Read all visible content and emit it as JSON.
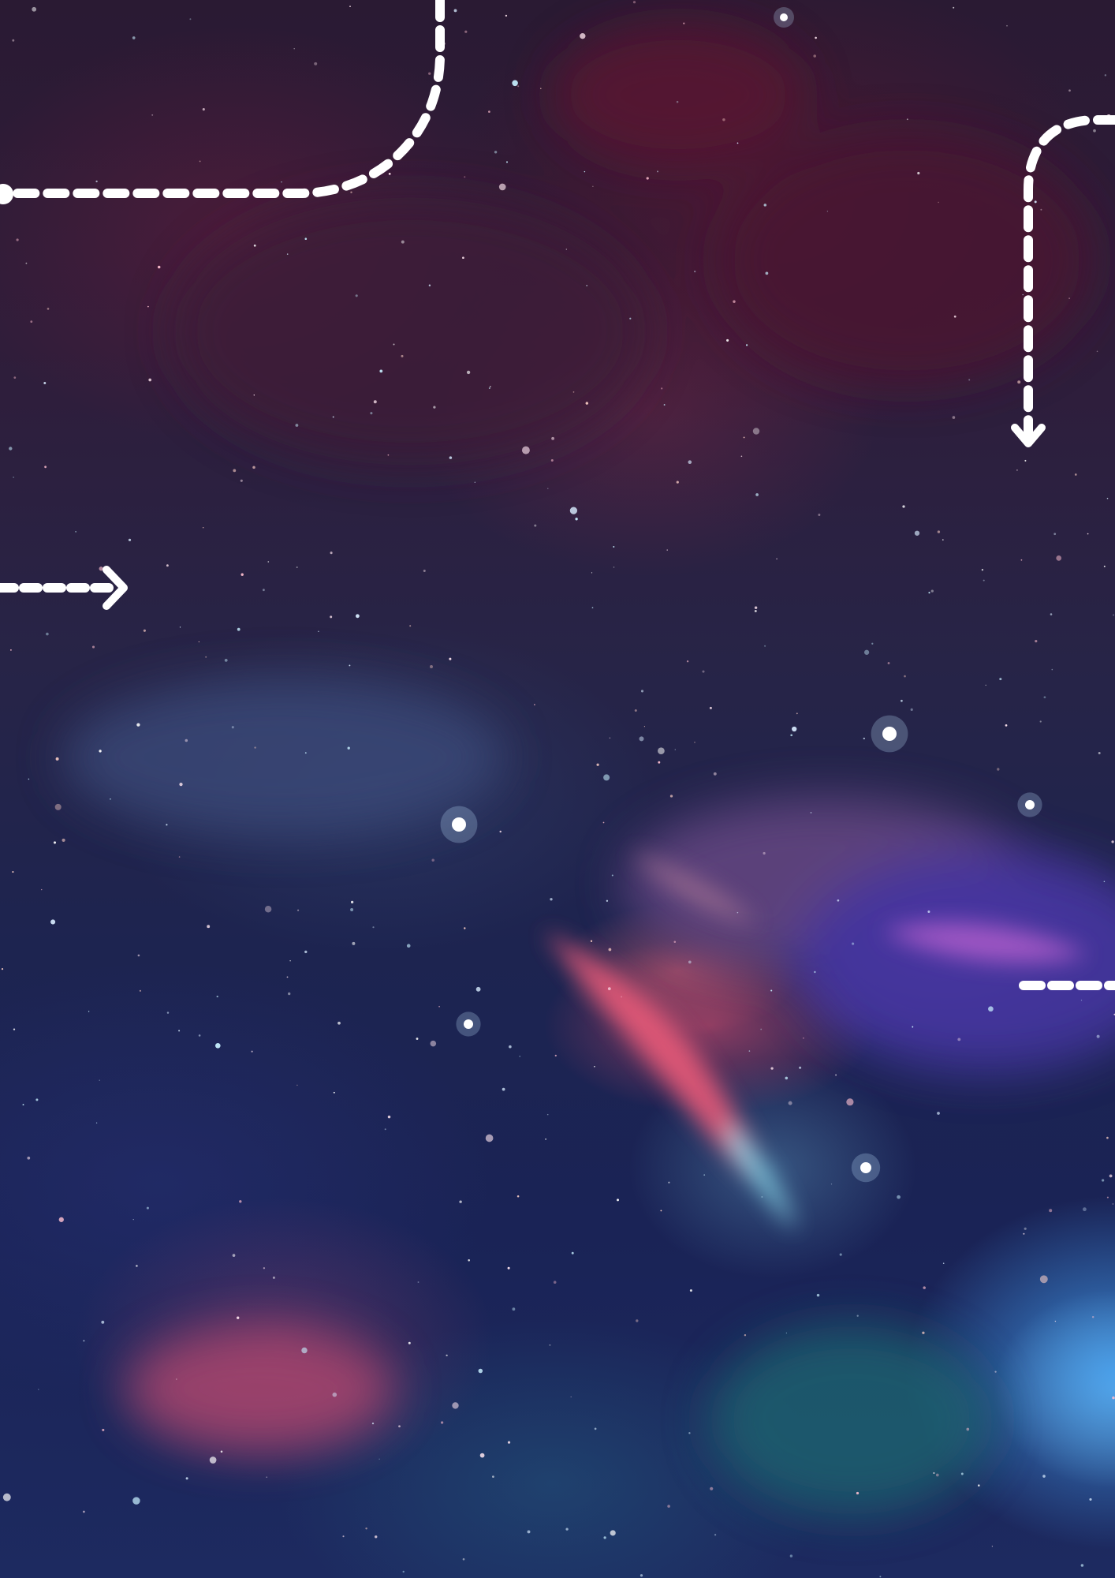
{
  "scene": {
    "description_kind": "space nebula background with dashed arrow decorations",
    "palette": {
      "deep": "#1a2356",
      "plum": "#2f1d3a",
      "nebula_red": "#e6506e",
      "nebula_cyan": "#78c8e6",
      "glow_blue": "#46aaff",
      "arrow": "#ffffff"
    }
  },
  "decorations": {
    "arrows": [
      {
        "name": "top-left-dashed-connector",
        "icon": "dashed-curve-connector"
      },
      {
        "name": "top-right-dashed-down-arrow",
        "icon": "chevron-down-icon"
      },
      {
        "name": "left-dashed-right-arrow",
        "icon": "chevron-right-icon"
      },
      {
        "name": "right-dashed-line",
        "icon": "dashed-line"
      }
    ]
  }
}
